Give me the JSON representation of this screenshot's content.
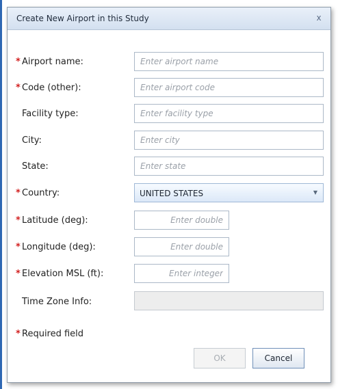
{
  "dialog": {
    "title": "Create New Airport in this Study",
    "close_glyph": "x"
  },
  "fields": {
    "airport_name": {
      "label": "Airport name:",
      "required": true,
      "value": "",
      "placeholder": "Enter airport name"
    },
    "code": {
      "label": "Code (other):",
      "required": true,
      "value": "",
      "placeholder": "Enter airport code"
    },
    "facility_type": {
      "label": "Facility type:",
      "required": false,
      "value": "",
      "placeholder": "Enter facility type"
    },
    "city": {
      "label": "City:",
      "required": false,
      "value": "",
      "placeholder": "Enter city"
    },
    "state": {
      "label": "State:",
      "required": false,
      "value": "",
      "placeholder": "Enter state"
    },
    "country": {
      "label": "Country:",
      "required": true,
      "selected": "UNITED STATES"
    },
    "latitude": {
      "label": "Latitude (deg):",
      "required": true,
      "value": "",
      "placeholder": "Enter double"
    },
    "longitude": {
      "label": "Longitude (deg):",
      "required": true,
      "value": "",
      "placeholder": "Enter double"
    },
    "elevation": {
      "label": "Elevation MSL (ft):",
      "required": true,
      "value": "",
      "placeholder": "Enter integer"
    },
    "time_zone": {
      "label": "Time Zone Info:",
      "required": false,
      "value": "",
      "disabled": true
    }
  },
  "required_marker": "*",
  "required_note": "Required field",
  "buttons": {
    "ok_label": "OK",
    "ok_disabled": true,
    "cancel_label": "Cancel"
  },
  "colors": {
    "required_star": "#d21f1f",
    "title_bar": "#d3e0f0",
    "screen_edge": "#2f68b3"
  },
  "icons": {
    "close": "close-icon",
    "dropdown": "chevron-down-icon"
  }
}
